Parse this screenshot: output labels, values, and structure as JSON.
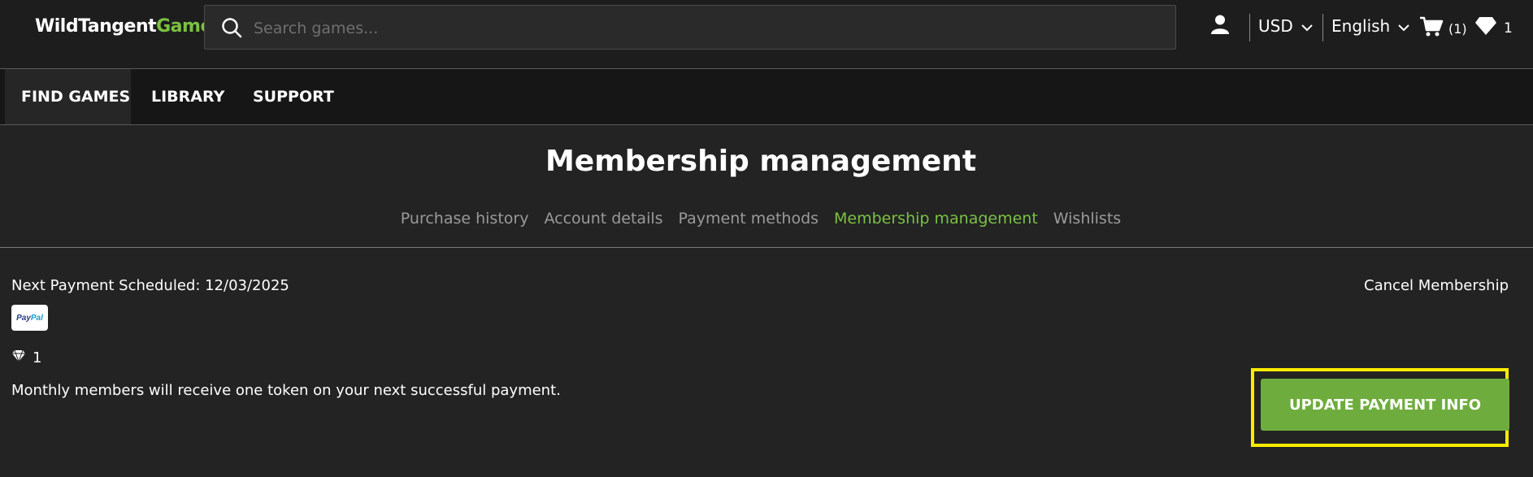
{
  "brand": {
    "logo_part1": "WildTangent",
    "logo_part2": "Games",
    "accent": "#7ac143"
  },
  "search": {
    "placeholder": "Search games..."
  },
  "header": {
    "currency": "USD",
    "language": "English",
    "cart_count": "(1)",
    "gem_count": "1"
  },
  "nav": {
    "items": [
      "FIND GAMES",
      "LIBRARY",
      "SUPPORT"
    ]
  },
  "page": {
    "title": "Membership management"
  },
  "subnav": {
    "items": [
      "Purchase history",
      "Account details",
      "Payment methods",
      "Membership management",
      "Wishlists"
    ]
  },
  "membership": {
    "next_payment": "Next Payment Scheduled: 12/03/2025",
    "payment_logo": "PayPal",
    "payment_logo_part1": "Pay",
    "payment_logo_part2": "Pal",
    "tokens": "1",
    "token_message": "Monthly members will receive one token on your next successful payment.",
    "cancel_label": "Cancel Membership",
    "update_label": "UPDATE PAYMENT INFO"
  }
}
